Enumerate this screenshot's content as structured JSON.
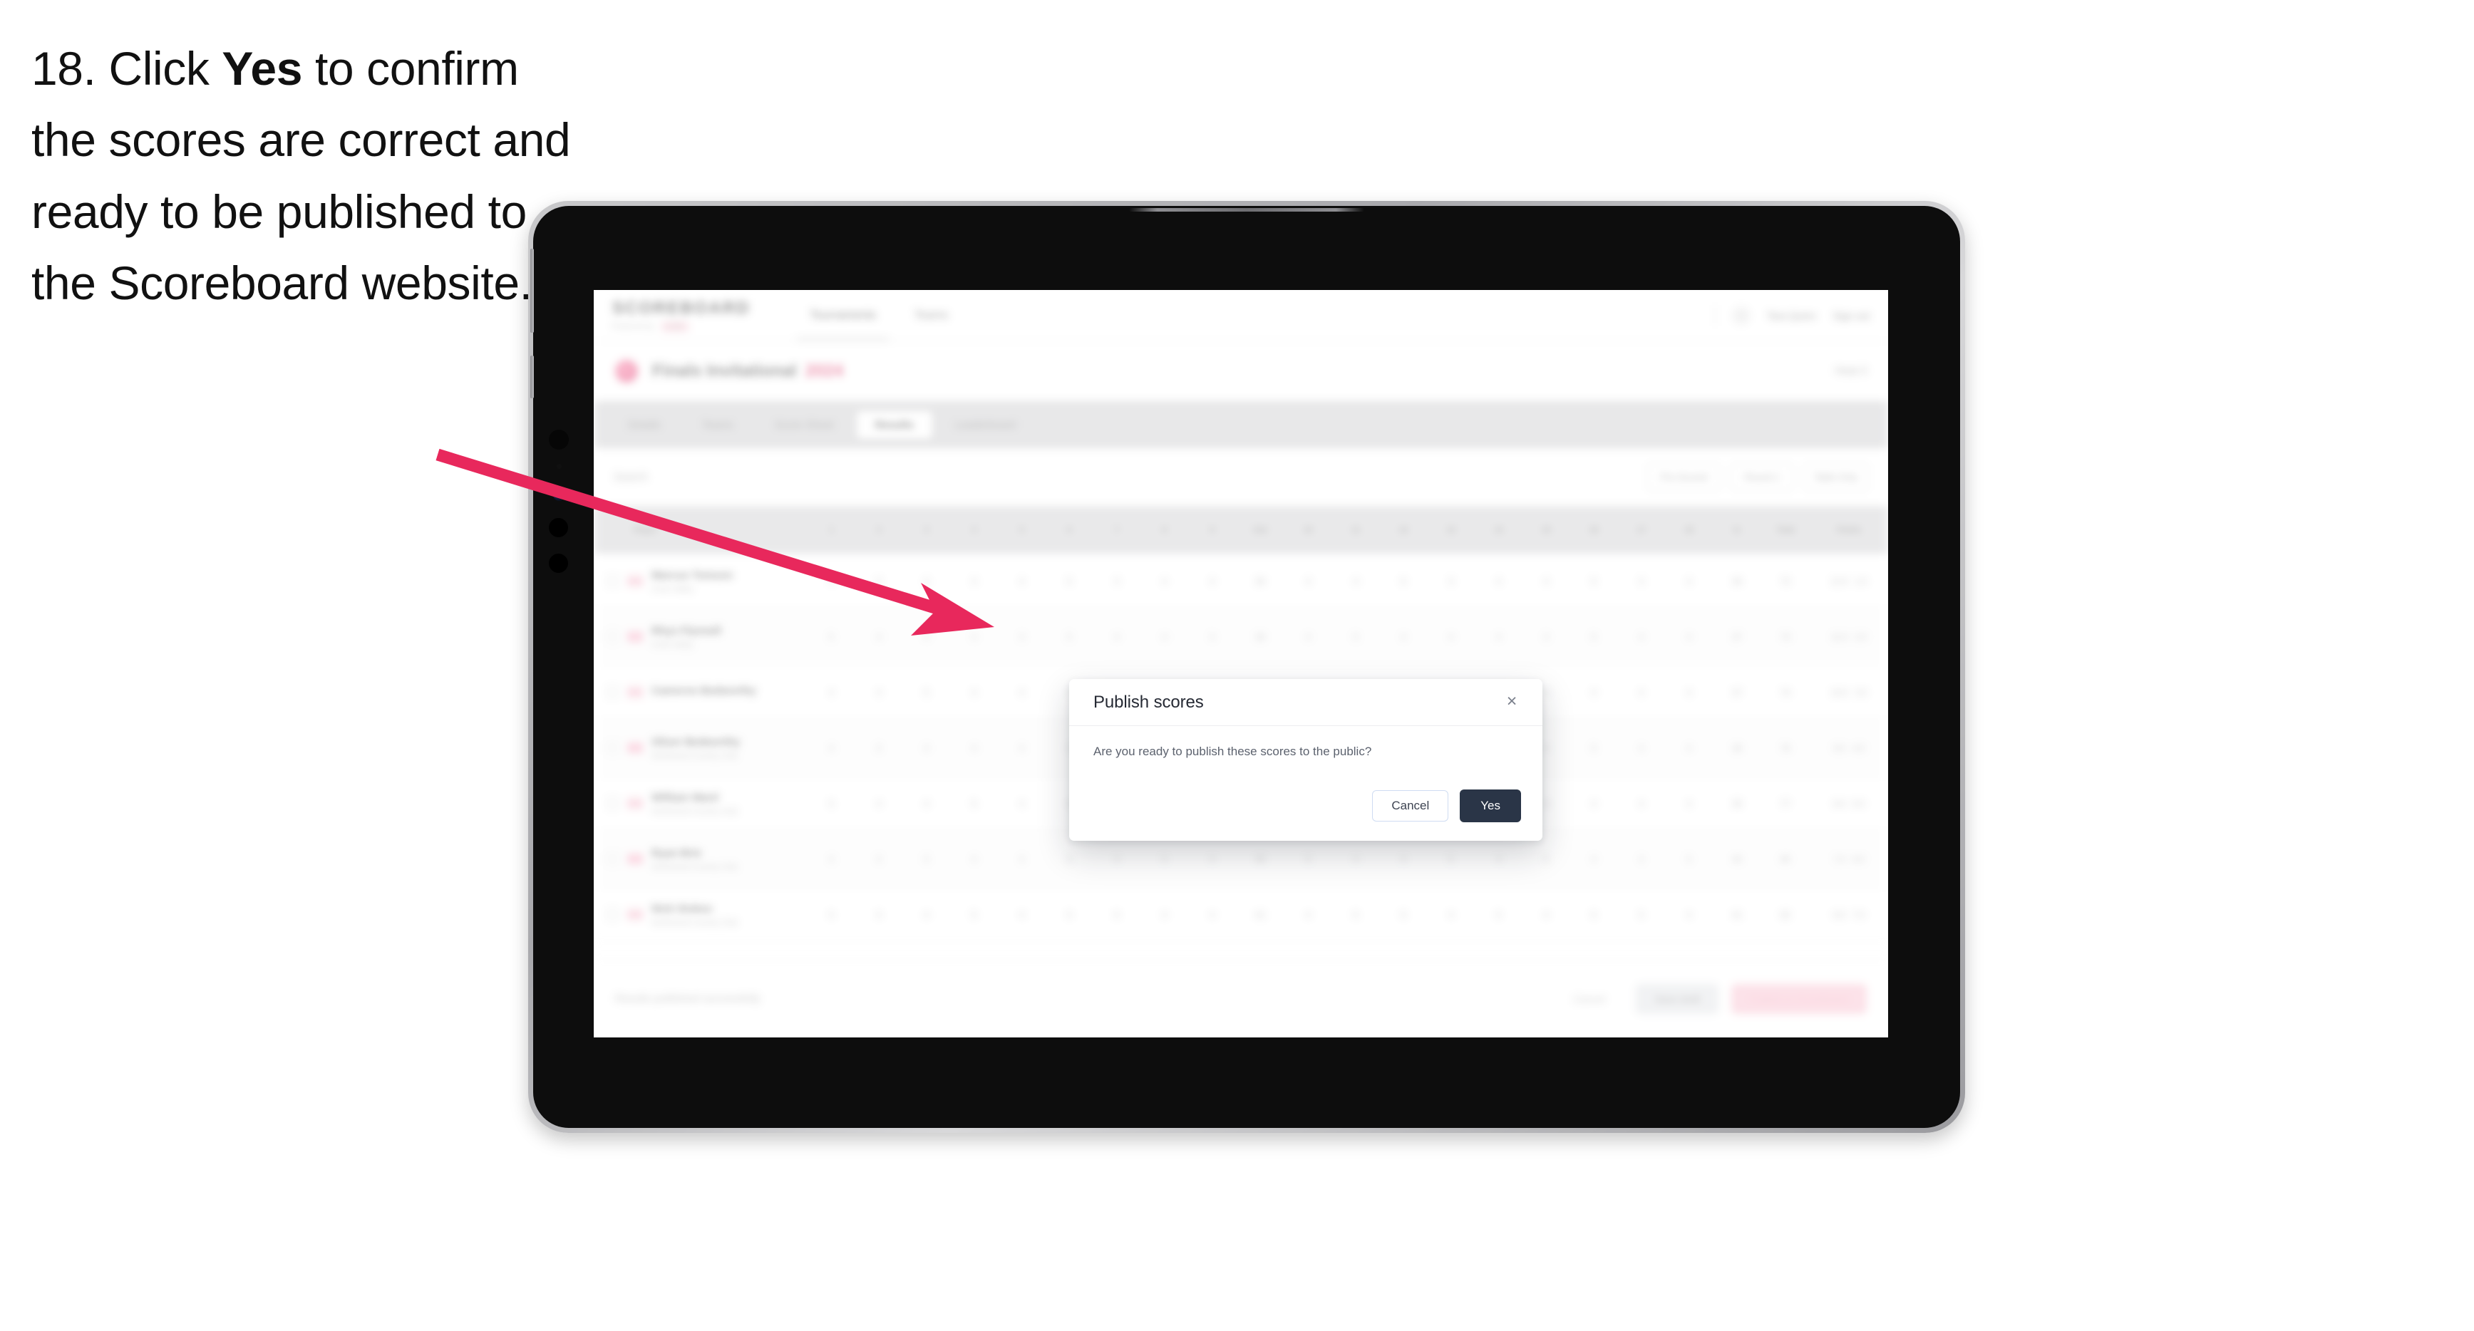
{
  "instruction": {
    "prefix": "18. Click ",
    "emphasis": "Yes",
    "suffix": " to confirm the scores are correct and ready to be published to the Scoreboard website."
  },
  "colors": {
    "arrow": "#E8285C",
    "accent_pink": "#E0386A",
    "dialog_primary": "#2A3547",
    "tab_bar": "#D2D2D4"
  },
  "app": {
    "brand": {
      "word": "SCOREBOARD",
      "sub": "Powered by",
      "pill": "LIVE"
    },
    "nav": [
      {
        "label": "Tournaments"
      },
      {
        "label": "Teams"
      }
    ],
    "top_right": {
      "user": "Tara Quinn",
      "signout": "Sign out"
    },
    "event": {
      "title": "Finals Invitational",
      "year": "2024",
      "right": "Heat 3"
    },
    "tabs": [
      {
        "label": "Details",
        "active": false
      },
      {
        "label": "Teams",
        "active": false
      },
      {
        "label": "Score Sheet",
        "active": false
      },
      {
        "label": "Results",
        "active": true
      },
      {
        "label": "Leaderboard",
        "active": false
      }
    ],
    "filters": {
      "search_placeholder": "Search",
      "controls": [
        "Pre-Scored",
        "Round 1",
        "Table Only"
      ]
    },
    "table": {
      "headers": [
        "Player",
        "1",
        "2",
        "3",
        "4",
        "5",
        "6",
        "7",
        "8",
        "9",
        "Out",
        "10",
        "11",
        "12",
        "13",
        "14",
        "15",
        "16",
        "17",
        "18",
        "In",
        "Total",
        "Points"
      ],
      "rows": [
        {
          "flag": "#f8c4d3",
          "name": "Marcus Tomson",
          "club": "Crest Valley",
          "scores": [
            "4",
            "5",
            "4",
            "3",
            "4",
            "5",
            "3",
            "4",
            "4"
          ],
          "out": "36",
          "scores2": [
            "4",
            "4",
            "5",
            "3",
            "4",
            "4",
            "5",
            "3",
            "4"
          ],
          "in": "36",
          "total": "72",
          "points": "12.0"
        },
        {
          "flag": "#f9b9cd",
          "name": "Rhys Flynnell",
          "club": "Crest Valley",
          "scores": [
            "5",
            "4",
            "4",
            "4",
            "3",
            "5",
            "4",
            "4",
            "3"
          ],
          "out": "36",
          "scores2": [
            "4",
            "5",
            "4",
            "4",
            "4",
            "3",
            "5",
            "4",
            "4"
          ],
          "in": "37",
          "total": "73",
          "points": "11.0"
        },
        {
          "flag": "#f8c4d3",
          "name": "Cameron Bedworthy",
          "club": "",
          "scores": [
            "4",
            "4",
            "5",
            "4",
            "4",
            "4",
            "4",
            "5",
            "3"
          ],
          "out": "37",
          "scores2": [
            "5",
            "4",
            "4",
            "4",
            "4",
            "4",
            "4",
            "4",
            "4"
          ],
          "in": "37",
          "total": "74",
          "points": "10.0"
        },
        {
          "flag": "#f9b9cd",
          "name": "Oliver Bedworthy",
          "club": "Northwood Country Club",
          "scores": [
            "4",
            "5",
            "4",
            "4",
            "4",
            "5",
            "4",
            "4",
            "4"
          ],
          "out": "38",
          "scores2": [
            "4",
            "4",
            "5",
            "4",
            "4",
            "4",
            "5",
            "4",
            "4"
          ],
          "in": "38",
          "total": "76",
          "points": "9.0"
        },
        {
          "flag": "#f8c4d3",
          "name": "William Ward",
          "club": "Northwood Country Club",
          "scores": [
            "5",
            "4",
            "4",
            "5",
            "4",
            "4",
            "4",
            "4",
            "5"
          ],
          "out": "39",
          "scores2": [
            "4",
            "5",
            "4",
            "4",
            "5",
            "4",
            "4",
            "4",
            "4"
          ],
          "in": "38",
          "total": "77",
          "points": "8.0"
        },
        {
          "flag": "#f9b9cd",
          "name": "Ryan Brie",
          "club": "Northwood Country Club",
          "scores": [
            "4",
            "5",
            "5",
            "4",
            "4",
            "5",
            "4",
            "5",
            "4"
          ],
          "out": "40",
          "scores2": [
            "5",
            "4",
            "4",
            "5",
            "4",
            "5",
            "4",
            "4",
            "5"
          ],
          "in": "40",
          "total": "80",
          "points": "7.0"
        },
        {
          "flag": "#f8c4d3",
          "name": "Nick Stokes",
          "club": "Northwood Country Club",
          "scores": [
            "5",
            "5",
            "4",
            "5",
            "4",
            "5",
            "5",
            "4",
            "4"
          ],
          "out": "41",
          "scores2": [
            "4",
            "5",
            "5",
            "4",
            "5",
            "4",
            "5",
            "5",
            "4"
          ],
          "in": "41",
          "total": "82",
          "points": "6.0"
        }
      ]
    },
    "footer": {
      "note": "Results published successfully",
      "ghost": "Cancel",
      "grey": "Save draft",
      "pink": "Publish to Scoreboard"
    }
  },
  "dialog": {
    "title": "Publish scores",
    "message": "Are you ready to publish these scores to the public?",
    "close_icon": "×",
    "cancel_label": "Cancel",
    "confirm_label": "Yes"
  }
}
